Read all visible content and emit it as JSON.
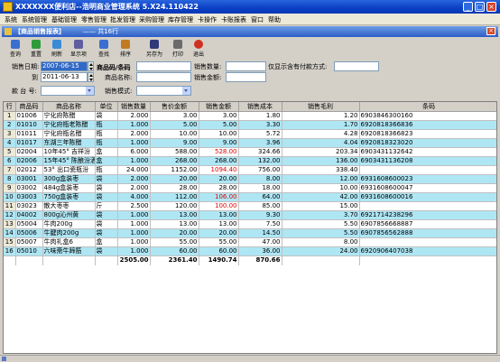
{
  "window": {
    "title": "XXXXXXX便利店--浩明商业管理系统 5.X24.110422",
    "minimize": "_",
    "maximize": "□",
    "close": "×"
  },
  "menu": [
    "系统",
    "系统管理",
    "基础管理",
    "零售管理",
    "批发管理",
    "采购管理",
    "库存管理",
    "卡操作",
    "卡账报表",
    "窗口",
    "帮助"
  ],
  "doc": {
    "title": "【商品销售报表】",
    "count": "—— 共16行",
    "close": "×"
  },
  "toolbar": [
    {
      "label": "查询",
      "icon": "search-icon",
      "color": "#3a6ed0"
    },
    {
      "label": "重置",
      "icon": "reset-icon",
      "color": "#2f9a3c"
    },
    {
      "label": "刷新",
      "icon": "refresh-icon",
      "color": "#3a8ad8"
    },
    {
      "label": "显示项",
      "icon": "columns-icon",
      "color": "#5e5e9e"
    },
    {
      "label": "查找",
      "icon": "find-icon",
      "color": "#3a6ed0"
    },
    {
      "label": "排序",
      "icon": "sort-icon",
      "color": "#c07a20"
    },
    {
      "label": "另存为",
      "icon": "save-as-icon",
      "color": "#303878"
    },
    {
      "label": "打印",
      "icon": "print-icon",
      "color": "#6a6a6a"
    },
    {
      "label": "退出",
      "icon": "exit-icon",
      "color": "#d03020"
    }
  ],
  "filters": {
    "date_label": "销售日期:",
    "date_from": "2007-06-15",
    "to_label": "到",
    "date_to": "2011-06-13",
    "code_label": "商品码/条码",
    "name_label": "商品名称:",
    "qty_label": "销售数量:",
    "amount_label": "销售金额:",
    "payment_label": "仅显示含有付款方式:",
    "stall_label": "款 台 号:",
    "mode_label": "销售模式:"
  },
  "table": {
    "columns": [
      "行",
      "商品码",
      "商品名称",
      "单位",
      "销售数量",
      "售价金额",
      "销售金额",
      "销售成本",
      "销售毛利",
      "条码"
    ],
    "rows": [
      [
        "1",
        "01006",
        "宁化府陈醋",
        "袋",
        "2.000",
        "3.00",
        "3.00",
        "1.80",
        "1.20",
        "6903846300160"
      ],
      [
        "2",
        "01010",
        "宁化府瓶老陈醋",
        "瓶",
        "1.000",
        "5.00",
        "5.00",
        "3.30",
        "1.70",
        "6920818366836"
      ],
      [
        "3",
        "01011",
        "宁化府瓶名醋",
        "瓶",
        "2.000",
        "10.00",
        "10.00",
        "5.72",
        "4.28",
        "6920818366823"
      ],
      [
        "4",
        "01017",
        "东湖三年陈醋",
        "瓶",
        "1.000",
        "9.00",
        "9.00",
        "3.96",
        "4.04",
        "6920818323020"
      ],
      [
        "5",
        "02004",
        "10年45° 吉祥汾",
        "盒",
        "6.000",
        "588.00",
        "528.00",
        "324.66",
        "203.34",
        "6903431132642"
      ],
      [
        "6",
        "02006",
        "15年45° 陈酿汾酒",
        "盒",
        "1.000",
        "268.00",
        "268.00",
        "132.00",
        "136.00",
        "6903431136208"
      ],
      [
        "7",
        "02012",
        "53° 出口瓷瓶汾",
        "瓶",
        "24.000",
        "1152.00",
        "1094.40",
        "756.00",
        "338.40",
        ""
      ],
      [
        "8",
        "03001",
        "300g盒装枣",
        "袋",
        "2.000",
        "20.00",
        "20.00",
        "8.00",
        "12.00",
        "6931608600023"
      ],
      [
        "9",
        "03002",
        "484g盒装枣",
        "袋",
        "2.000",
        "28.00",
        "28.00",
        "18.00",
        "10.00",
        "6931608600047"
      ],
      [
        "10",
        "03003",
        "750g盒装枣",
        "袋",
        "4.000",
        "112.00",
        "106.00",
        "64.00",
        "42.00",
        "6931608600016"
      ],
      [
        "11",
        "03023",
        "散大枣枣",
        "斤",
        "2.500",
        "120.00",
        "100.00",
        "85.00",
        "15.00",
        ""
      ],
      [
        "12",
        "04002",
        "800g沁州黄",
        "袋",
        "1.000",
        "13.00",
        "13.00",
        "9.30",
        "3.70",
        "6921714238296"
      ],
      [
        "13",
        "05004",
        "牛肉200g",
        "袋",
        "1.000",
        "13.00",
        "13.00",
        "7.50",
        "5.50",
        "6907856668887"
      ],
      [
        "14",
        "05006",
        "牛腱肉200g",
        "袋",
        "1.000",
        "20.00",
        "20.00",
        "14.50",
        "5.50",
        "6907856562888"
      ],
      [
        "15",
        "05007",
        "牛肉礼盒6",
        "盒",
        "1.000",
        "55.00",
        "55.00",
        "47.00",
        "8.00",
        ""
      ],
      [
        "16",
        "05010",
        "六味斋牛蹄筋",
        "袋",
        "1.000",
        "60.00",
        "60.00",
        "36.00",
        "24.00",
        "6920906407038"
      ]
    ],
    "red_cells": [
      [
        4,
        6
      ],
      [
        6,
        6
      ],
      [
        9,
        6
      ],
      [
        10,
        6
      ]
    ],
    "totals": [
      "",
      "",
      "",
      "",
      "2505.00",
      "2361.40",
      "1490.74",
      "870.66",
      "",
      ""
    ]
  },
  "colors": {
    "accent": "#2a65dc",
    "row_alt": "#aee6f4",
    "negative": "#e00000",
    "selection": "#3169c6"
  }
}
